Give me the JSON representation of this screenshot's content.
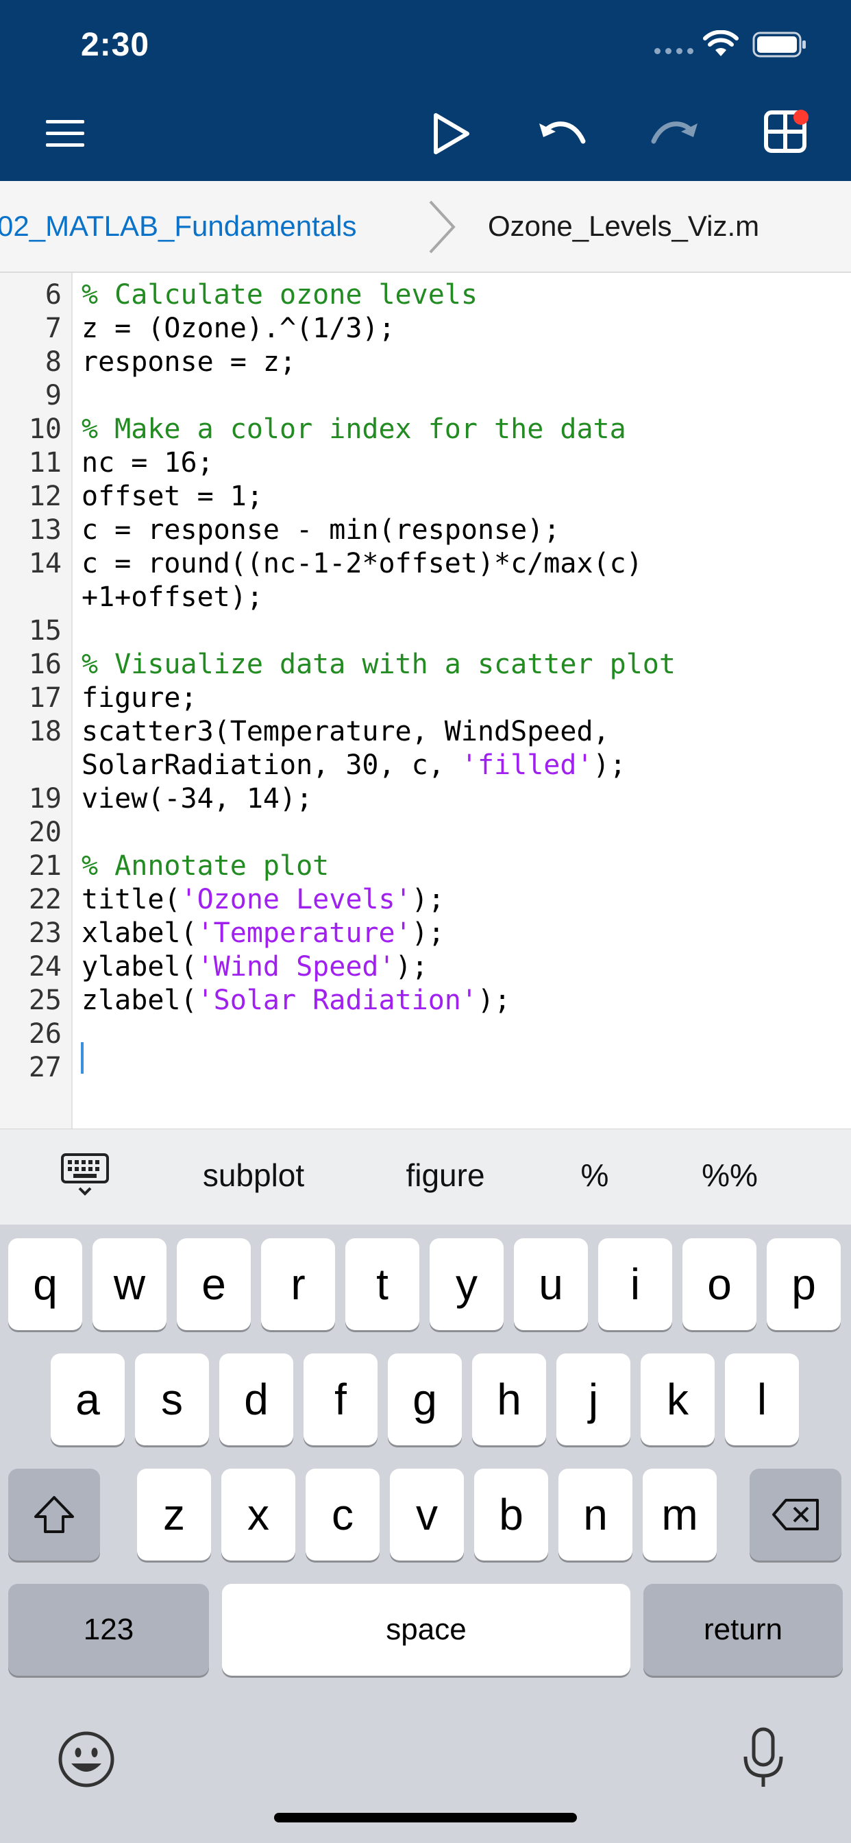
{
  "status_bar": {
    "time": "2:30",
    "icons": [
      "signal-icon",
      "wifi-icon",
      "battery-icon"
    ]
  },
  "toolbar": {
    "icons": [
      "menu-icon",
      "run-icon",
      "undo-icon",
      "redo-icon",
      "grid-icon"
    ],
    "colors": {
      "background": "#073c70",
      "badge": "#ff3b30"
    }
  },
  "breadcrumb": {
    "folder": "02_MATLAB_Fundamentals",
    "file": "Ozone_Levels_Viz.m"
  },
  "editor": {
    "lines": [
      {
        "num": "6",
        "parts": [
          {
            "t": "% Calculate ozone levels",
            "c": "cmt"
          }
        ]
      },
      {
        "num": "7",
        "parts": [
          {
            "t": "z = (Ozone).^(1/3);",
            "c": ""
          }
        ]
      },
      {
        "num": "8",
        "parts": [
          {
            "t": "response = z;",
            "c": ""
          }
        ]
      },
      {
        "num": "9",
        "parts": []
      },
      {
        "num": "10",
        "parts": [
          {
            "t": "% Make a color index for the data",
            "c": "cmt"
          }
        ]
      },
      {
        "num": "11",
        "parts": [
          {
            "t": "nc = 16;",
            "c": ""
          }
        ]
      },
      {
        "num": "12",
        "parts": [
          {
            "t": "offset = 1;",
            "c": ""
          }
        ]
      },
      {
        "num": "13",
        "parts": [
          {
            "t": "c = response - min(response);",
            "c": ""
          }
        ]
      },
      {
        "num": "14",
        "parts": [
          {
            "t": "c = round((nc-1-2*offset)*c/max(c)",
            "c": ""
          }
        ]
      },
      {
        "num": "",
        "parts": [
          {
            "t": "+1+offset);",
            "c": ""
          }
        ]
      },
      {
        "num": "15",
        "parts": []
      },
      {
        "num": "16",
        "parts": [
          {
            "t": "% Visualize data with a scatter plot",
            "c": "cmt"
          }
        ]
      },
      {
        "num": "17",
        "parts": [
          {
            "t": "figure;",
            "c": ""
          }
        ]
      },
      {
        "num": "18",
        "parts": [
          {
            "t": "scatter3(Temperature, WindSpeed,",
            "c": ""
          }
        ]
      },
      {
        "num": "",
        "parts": [
          {
            "t": "SolarRadiation, 30, c, ",
            "c": ""
          },
          {
            "t": "'filled'",
            "c": "str"
          },
          {
            "t": ");",
            "c": ""
          }
        ]
      },
      {
        "num": "19",
        "parts": [
          {
            "t": "view(-34, 14);",
            "c": ""
          }
        ]
      },
      {
        "num": "20",
        "parts": []
      },
      {
        "num": "21",
        "parts": [
          {
            "t": "% Annotate plot",
            "c": "cmt"
          }
        ]
      },
      {
        "num": "22",
        "parts": [
          {
            "t": "title(",
            "c": ""
          },
          {
            "t": "'Ozone Levels'",
            "c": "str"
          },
          {
            "t": ");",
            "c": ""
          }
        ]
      },
      {
        "num": "23",
        "parts": [
          {
            "t": "xlabel(",
            "c": ""
          },
          {
            "t": "'Temperature'",
            "c": "str"
          },
          {
            "t": ");",
            "c": ""
          }
        ]
      },
      {
        "num": "24",
        "parts": [
          {
            "t": "ylabel(",
            "c": ""
          },
          {
            "t": "'Wind Speed'",
            "c": "str"
          },
          {
            "t": ");",
            "c": ""
          }
        ]
      },
      {
        "num": "25",
        "parts": [
          {
            "t": "zlabel(",
            "c": ""
          },
          {
            "t": "'Solar Radiation'",
            "c": "str"
          },
          {
            "t": ");",
            "c": ""
          }
        ]
      },
      {
        "num": "26",
        "parts": []
      },
      {
        "num": "27",
        "parts": []
      }
    ],
    "colors": {
      "comment": "#228b22",
      "string": "#a020f0",
      "cursor": "#3b8fe0"
    }
  },
  "suggestions": {
    "keyboard_toggle_icon": "keyboard-icon",
    "items": [
      "subplot",
      "figure",
      "%",
      "%%"
    ]
  },
  "keyboard": {
    "row1": [
      "q",
      "w",
      "e",
      "r",
      "t",
      "y",
      "u",
      "i",
      "o",
      "p"
    ],
    "row2": [
      "a",
      "s",
      "d",
      "f",
      "g",
      "h",
      "j",
      "k",
      "l"
    ],
    "row3": [
      "z",
      "x",
      "c",
      "v",
      "b",
      "n",
      "m"
    ],
    "numbers_label": "123",
    "space_label": "space",
    "return_label": "return",
    "icons": [
      "shift-icon",
      "backspace-icon",
      "emoji-icon",
      "microphone-icon"
    ]
  }
}
